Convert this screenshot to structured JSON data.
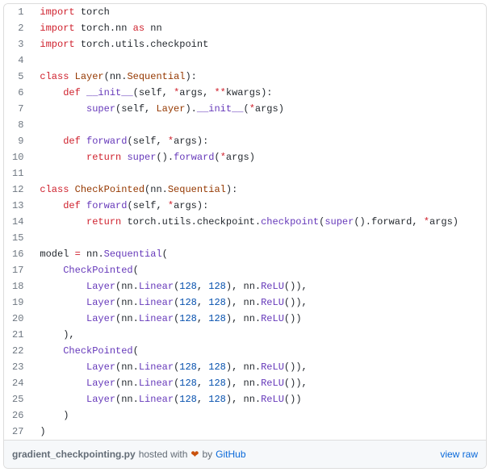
{
  "code": {
    "lines": [
      {
        "n": 1,
        "tokens": [
          [
            "kw",
            "import"
          ],
          [
            "plain",
            " "
          ],
          [
            "nn",
            "torch"
          ]
        ]
      },
      {
        "n": 2,
        "tokens": [
          [
            "kw",
            "import"
          ],
          [
            "plain",
            " "
          ],
          [
            "nn",
            "torch"
          ],
          [
            "plain",
            "."
          ],
          [
            "nn",
            "nn"
          ],
          [
            "plain",
            " "
          ],
          [
            "kw",
            "as"
          ],
          [
            "plain",
            " "
          ],
          [
            "nn",
            "nn"
          ]
        ]
      },
      {
        "n": 3,
        "tokens": [
          [
            "kw",
            "import"
          ],
          [
            "plain",
            " "
          ],
          [
            "nn",
            "torch"
          ],
          [
            "plain",
            "."
          ],
          [
            "nn",
            "utils"
          ],
          [
            "plain",
            "."
          ],
          [
            "nn",
            "checkpoint"
          ]
        ]
      },
      {
        "n": 4,
        "tokens": []
      },
      {
        "n": 5,
        "tokens": [
          [
            "kw",
            "class"
          ],
          [
            "plain",
            " "
          ],
          [
            "class",
            "Layer"
          ],
          [
            "plain",
            "("
          ],
          [
            "nn",
            "nn"
          ],
          [
            "plain",
            "."
          ],
          [
            "class",
            "Sequential"
          ],
          [
            "plain",
            "):"
          ]
        ]
      },
      {
        "n": 6,
        "tokens": [
          [
            "plain",
            "    "
          ],
          [
            "kw",
            "def"
          ],
          [
            "plain",
            " "
          ],
          [
            "func",
            "__init__"
          ],
          [
            "plain",
            "("
          ],
          [
            "self",
            "self"
          ],
          [
            "plain",
            ", "
          ],
          [
            "op",
            "*"
          ],
          [
            "param",
            "args"
          ],
          [
            "plain",
            ", "
          ],
          [
            "op",
            "**"
          ],
          [
            "param",
            "kwargs"
          ],
          [
            "plain",
            "):"
          ]
        ]
      },
      {
        "n": 7,
        "tokens": [
          [
            "plain",
            "        "
          ],
          [
            "call",
            "super"
          ],
          [
            "plain",
            "("
          ],
          [
            "self",
            "self"
          ],
          [
            "plain",
            ", "
          ],
          [
            "class",
            "Layer"
          ],
          [
            "plain",
            "])."
          ],
          [
            "call",
            "__init__"
          ],
          [
            "plain",
            "("
          ],
          [
            "op",
            "*"
          ],
          [
            "param",
            "args"
          ],
          [
            "plain",
            ")"
          ]
        ]
      },
      {
        "n": 8,
        "tokens": []
      },
      {
        "n": 9,
        "tokens": [
          [
            "plain",
            "    "
          ],
          [
            "kw",
            "def"
          ],
          [
            "plain",
            " "
          ],
          [
            "func",
            "forward"
          ],
          [
            "plain",
            "("
          ],
          [
            "self",
            "self"
          ],
          [
            "plain",
            ", "
          ],
          [
            "op",
            "*"
          ],
          [
            "param",
            "args"
          ],
          [
            "plain",
            "):"
          ]
        ]
      },
      {
        "n": 10,
        "tokens": [
          [
            "plain",
            "        "
          ],
          [
            "kw",
            "return"
          ],
          [
            "plain",
            " "
          ],
          [
            "call",
            "super"
          ],
          [
            "plain",
            "()."
          ],
          [
            "call",
            "forward"
          ],
          [
            "plain",
            "("
          ],
          [
            "op",
            "*"
          ],
          [
            "param",
            "args"
          ],
          [
            "plain",
            ")"
          ]
        ]
      },
      {
        "n": 11,
        "tokens": []
      },
      {
        "n": 12,
        "tokens": [
          [
            "kw",
            "class"
          ],
          [
            "plain",
            " "
          ],
          [
            "class",
            "CheckPointed"
          ],
          [
            "plain",
            "("
          ],
          [
            "nn",
            "nn"
          ],
          [
            "plain",
            "."
          ],
          [
            "class",
            "Sequential"
          ],
          [
            "plain",
            "):"
          ]
        ]
      },
      {
        "n": 13,
        "tokens": [
          [
            "plain",
            "    "
          ],
          [
            "kw",
            "def"
          ],
          [
            "plain",
            " "
          ],
          [
            "func",
            "forward"
          ],
          [
            "plain",
            "("
          ],
          [
            "self",
            "self"
          ],
          [
            "plain",
            ", "
          ],
          [
            "op",
            "*"
          ],
          [
            "param",
            "args"
          ],
          [
            "plain",
            "):"
          ]
        ]
      },
      {
        "n": 14,
        "tokens": [
          [
            "plain",
            "        "
          ],
          [
            "kw",
            "return"
          ],
          [
            "plain",
            " "
          ],
          [
            "nn",
            "torch"
          ],
          [
            "plain",
            "."
          ],
          [
            "nn",
            "utils"
          ],
          [
            "plain",
            "."
          ],
          [
            "nn",
            "checkpoint"
          ],
          [
            "plain",
            "."
          ],
          [
            "call",
            "checkpoint"
          ],
          [
            "plain",
            "("
          ],
          [
            "call",
            "super"
          ],
          [
            "plain",
            "()."
          ],
          [
            "nn",
            "forward"
          ],
          [
            "plain",
            ", "
          ],
          [
            "op",
            "*"
          ],
          [
            "param",
            "args"
          ],
          [
            "plain",
            ")"
          ]
        ]
      },
      {
        "n": 15,
        "tokens": []
      },
      {
        "n": 16,
        "tokens": [
          [
            "nn",
            "model"
          ],
          [
            "plain",
            " "
          ],
          [
            "op",
            "="
          ],
          [
            "plain",
            " "
          ],
          [
            "nn",
            "nn"
          ],
          [
            "plain",
            "."
          ],
          [
            "call",
            "Sequential"
          ],
          [
            "plain",
            "("
          ]
        ]
      },
      {
        "n": 17,
        "tokens": [
          [
            "plain",
            "    "
          ],
          [
            "call",
            "CheckPointed"
          ],
          [
            "plain",
            "("
          ]
        ]
      },
      {
        "n": 18,
        "tokens": [
          [
            "plain",
            "        "
          ],
          [
            "call",
            "Layer"
          ],
          [
            "plain",
            "("
          ],
          [
            "nn",
            "nn"
          ],
          [
            "plain",
            "."
          ],
          [
            "call",
            "Linear"
          ],
          [
            "plain",
            "("
          ],
          [
            "num",
            "128"
          ],
          [
            "plain",
            ", "
          ],
          [
            "num",
            "128"
          ],
          [
            "plain",
            "), "
          ],
          [
            "nn",
            "nn"
          ],
          [
            "plain",
            "."
          ],
          [
            "call",
            "ReLU"
          ],
          [
            "plain",
            "()),"
          ]
        ]
      },
      {
        "n": 19,
        "tokens": [
          [
            "plain",
            "        "
          ],
          [
            "call",
            "Layer"
          ],
          [
            "plain",
            "("
          ],
          [
            "nn",
            "nn"
          ],
          [
            "plain",
            "."
          ],
          [
            "call",
            "Linear"
          ],
          [
            "plain",
            "("
          ],
          [
            "num",
            "128"
          ],
          [
            "plain",
            ", "
          ],
          [
            "num",
            "128"
          ],
          [
            "plain",
            "), "
          ],
          [
            "nn",
            "nn"
          ],
          [
            "plain",
            "."
          ],
          [
            "call",
            "ReLU"
          ],
          [
            "plain",
            "()),"
          ]
        ]
      },
      {
        "n": 20,
        "tokens": [
          [
            "plain",
            "        "
          ],
          [
            "call",
            "Layer"
          ],
          [
            "plain",
            "("
          ],
          [
            "nn",
            "nn"
          ],
          [
            "plain",
            "."
          ],
          [
            "call",
            "Linear"
          ],
          [
            "plain",
            "("
          ],
          [
            "num",
            "128"
          ],
          [
            "plain",
            ", "
          ],
          [
            "num",
            "128"
          ],
          [
            "plain",
            "), "
          ],
          [
            "nn",
            "nn"
          ],
          [
            "plain",
            "."
          ],
          [
            "call",
            "ReLU"
          ],
          [
            "plain",
            "())"
          ]
        ]
      },
      {
        "n": 21,
        "tokens": [
          [
            "plain",
            "    ),"
          ]
        ]
      },
      {
        "n": 22,
        "tokens": [
          [
            "plain",
            "    "
          ],
          [
            "call",
            "CheckPointed"
          ],
          [
            "plain",
            "("
          ]
        ]
      },
      {
        "n": 23,
        "tokens": [
          [
            "plain",
            "        "
          ],
          [
            "call",
            "Layer"
          ],
          [
            "plain",
            "("
          ],
          [
            "nn",
            "nn"
          ],
          [
            "plain",
            "."
          ],
          [
            "call",
            "Linear"
          ],
          [
            "plain",
            "("
          ],
          [
            "num",
            "128"
          ],
          [
            "plain",
            ", "
          ],
          [
            "num",
            "128"
          ],
          [
            "plain",
            "), "
          ],
          [
            "nn",
            "nn"
          ],
          [
            "plain",
            "."
          ],
          [
            "call",
            "ReLU"
          ],
          [
            "plain",
            "()),"
          ]
        ]
      },
      {
        "n": 24,
        "tokens": [
          [
            "plain",
            "        "
          ],
          [
            "call",
            "Layer"
          ],
          [
            "plain",
            "("
          ],
          [
            "nn",
            "nn"
          ],
          [
            "plain",
            "."
          ],
          [
            "call",
            "Linear"
          ],
          [
            "plain",
            "("
          ],
          [
            "num",
            "128"
          ],
          [
            "plain",
            ", "
          ],
          [
            "num",
            "128"
          ],
          [
            "plain",
            "), "
          ],
          [
            "nn",
            "nn"
          ],
          [
            "plain",
            "."
          ],
          [
            "call",
            "ReLU"
          ],
          [
            "plain",
            "()),"
          ]
        ]
      },
      {
        "n": 25,
        "tokens": [
          [
            "plain",
            "        "
          ],
          [
            "call",
            "Layer"
          ],
          [
            "plain",
            "("
          ],
          [
            "nn",
            "nn"
          ],
          [
            "plain",
            "."
          ],
          [
            "call",
            "Linear"
          ],
          [
            "plain",
            "("
          ],
          [
            "num",
            "128"
          ],
          [
            "plain",
            ", "
          ],
          [
            "num",
            "128"
          ],
          [
            "plain",
            "), "
          ],
          [
            "nn",
            "nn"
          ],
          [
            "plain",
            "."
          ],
          [
            "call",
            "ReLU"
          ],
          [
            "plain",
            "())"
          ]
        ]
      },
      {
        "n": 26,
        "tokens": [
          [
            "plain",
            "    )"
          ]
        ]
      },
      {
        "n": 27,
        "tokens": [
          [
            "plain",
            ")"
          ]
        ]
      }
    ]
  },
  "meta": {
    "filename": "gradient_checkpointing.py",
    "hosted_text": "hosted with",
    "by_text": "by",
    "host": "GitHub",
    "view_raw": "view raw"
  }
}
